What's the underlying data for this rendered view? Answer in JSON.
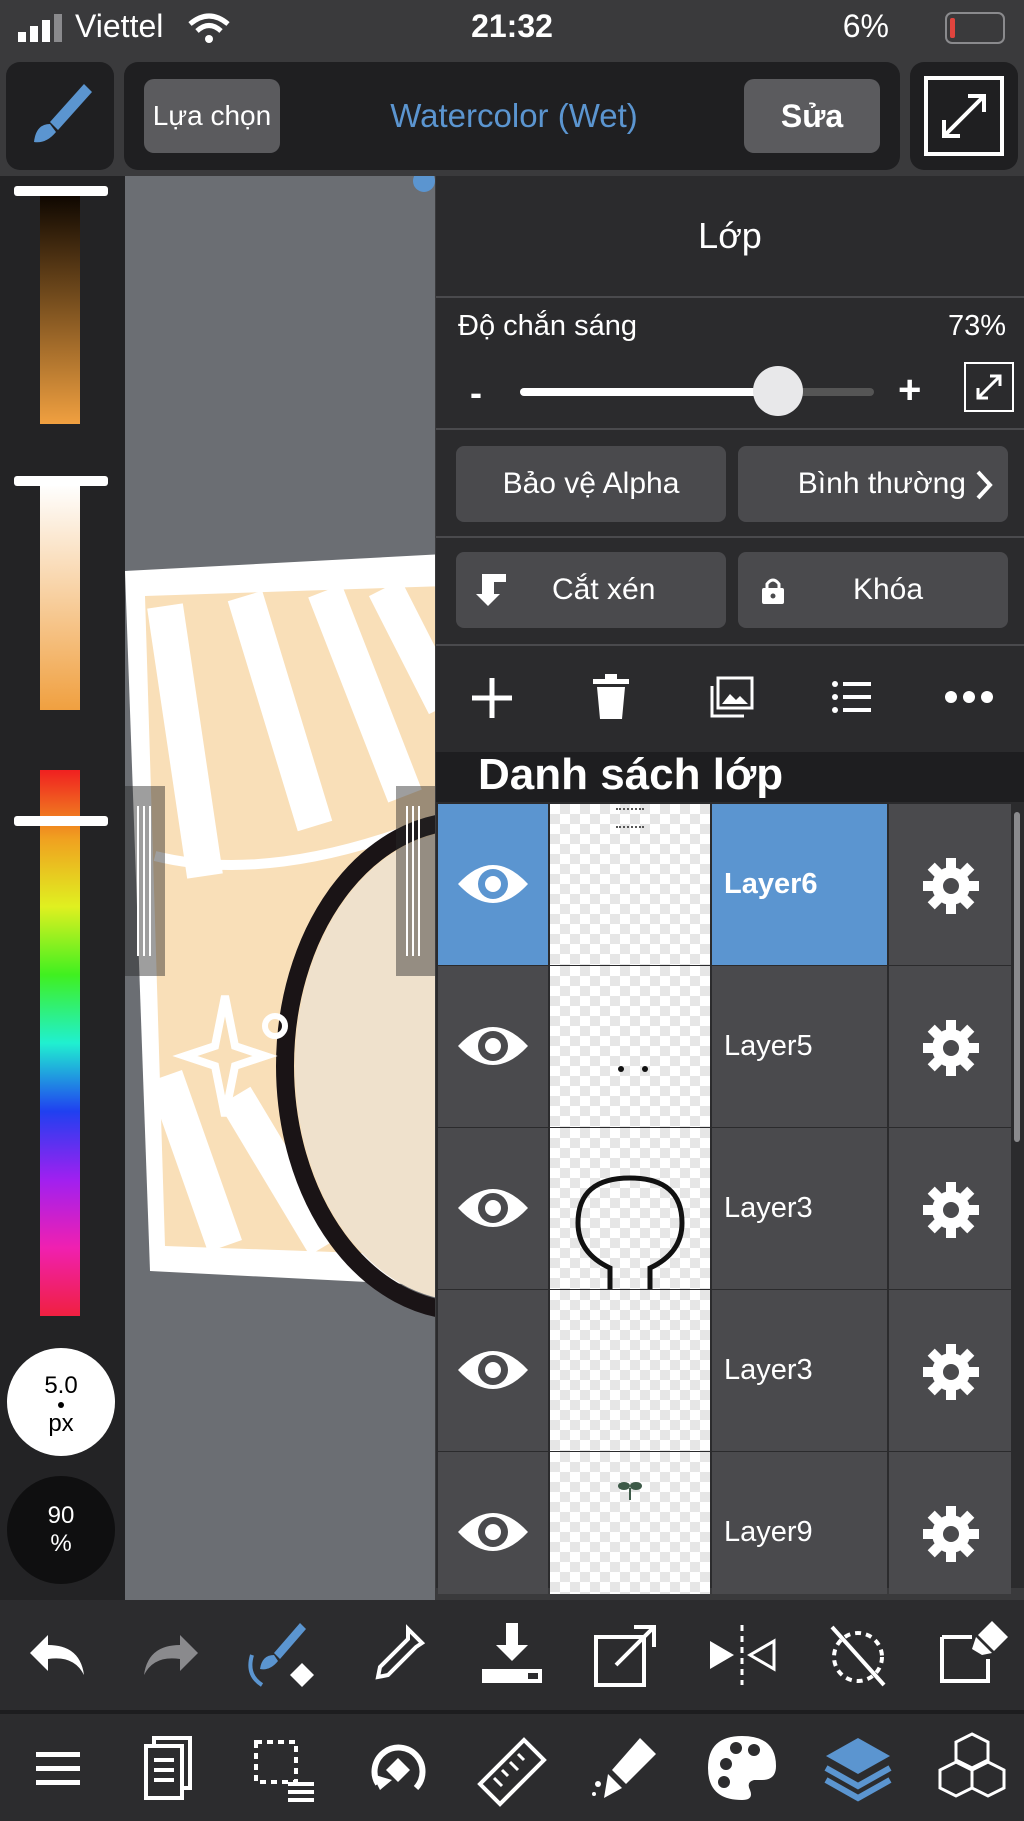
{
  "status": {
    "carrier": "Viettel",
    "time": "21:32",
    "battery": "6%"
  },
  "toolbar": {
    "select_label": "Lựa chọn",
    "brush_name": "Watercolor (Wet)",
    "edit_label": "Sửa"
  },
  "left": {
    "brush_size": "5.0",
    "brush_unit": "px",
    "opacity": "90",
    "opacity_unit": "%"
  },
  "panel": {
    "title": "Lớp",
    "opacity_label": "Độ chắn sáng",
    "opacity_value": "73%",
    "opacity_level": 0.73,
    "minus": "-",
    "plus": "+",
    "alpha_protect": "Bảo vệ Alpha",
    "blend_mode": "Bình thường",
    "clipping": "Cắt xén",
    "lock": "Khóa",
    "list_title": "Danh sách lớp",
    "layers": [
      {
        "name": "Layer6",
        "selected": true
      },
      {
        "name": "Layer5",
        "selected": false
      },
      {
        "name": "Layer3",
        "selected": false
      },
      {
        "name": "Layer3",
        "selected": false
      },
      {
        "name": "Layer9",
        "selected": false
      }
    ]
  },
  "colors": {
    "accent": "#5b95d0",
    "panel": "#2b2b2d",
    "row": "#4a4a4d"
  }
}
